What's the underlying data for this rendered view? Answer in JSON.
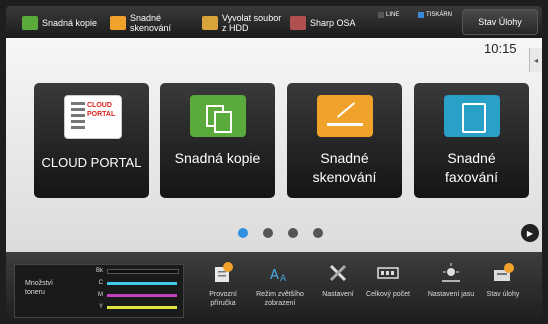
{
  "topbar": {
    "shortcuts": [
      {
        "label": "Snadná kopie",
        "icon": "copy-icon"
      },
      {
        "label": "Snadné skenování",
        "icon": "scan-icon"
      },
      {
        "label": "Vyvolat soubor z HDD",
        "icon": "folder-icon"
      },
      {
        "label": "Sharp OSA",
        "icon": "osa-icon"
      }
    ],
    "indicators": {
      "line": "LINE",
      "printer": "TISKÁRN"
    },
    "job_status_button": "Stav Úlohy"
  },
  "main": {
    "clock": "10:15",
    "tiles": [
      {
        "label": "CLOUD PORTAL",
        "icon": "cloud-portal-icon"
      },
      {
        "label": "Snadná kopie",
        "icon": "copy-icon"
      },
      {
        "label": "Snadné skenování",
        "icon": "scan-icon"
      },
      {
        "label": "Snadné faxování",
        "icon": "fax-icon"
      }
    ],
    "page": {
      "current": 1,
      "total": 4
    }
  },
  "bottombar": {
    "toner": {
      "title": "Množství toneru",
      "channels": [
        "Bk",
        "C",
        "M",
        "Y"
      ]
    },
    "buttons": [
      {
        "label": "Provozní příručka",
        "icon": "manual-icon"
      },
      {
        "label": "Režim zvětšího zobrazení",
        "icon": "enlarge-display-icon"
      },
      {
        "label": "Nastavení",
        "icon": "settings-tools-icon"
      },
      {
        "label": "Celkový počet",
        "icon": "counter-icon"
      },
      {
        "label": "Nastavení jasu",
        "icon": "brightness-icon"
      },
      {
        "label": "Stav úlohy",
        "icon": "job-status-icon"
      }
    ]
  },
  "colors": {
    "accent_blue": "#2f8fe0",
    "copy_green": "#5aaa3c",
    "scan_orange": "#f0a22a",
    "fax_cyan": "#2aa0c8"
  }
}
